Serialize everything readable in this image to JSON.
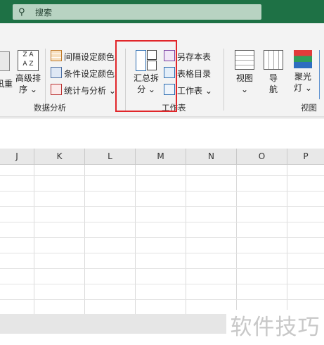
{
  "search": {
    "placeholder": "搜索",
    "icon": "search-icon"
  },
  "ribbon": {
    "analysis": {
      "partial_btn": "凪重",
      "advanced_sort": {
        "line1": "高级排",
        "line2": "序 ⌄"
      },
      "interval_color": "间隔设定颜色",
      "condition_color": "条件设定颜色",
      "stats": "统计与分析 ⌄",
      "group_label": "数据分析"
    },
    "worksheet": {
      "summary_split": {
        "line1": "汇总拆",
        "line2": "分 ⌄"
      },
      "save_as": "另存本表",
      "table_dir": "表格目录",
      "worksheet": "工作表 ⌄",
      "group_label": "工作表"
    },
    "view": {
      "view_btn": {
        "line1": "视图",
        "line2": "⌄"
      },
      "nav_btn": {
        "line1": "导",
        "line2": "航"
      },
      "spotlight_btn": {
        "line1": "聚光",
        "line2": "灯 ⌄"
      },
      "group_label": "视图"
    }
  },
  "columns": [
    "J",
    "K",
    "L",
    "M",
    "N",
    "O",
    "P"
  ],
  "watermark": "软件技巧",
  "colors": {
    "titlebar": "#1e7145",
    "highlight": "#e1262a",
    "ribbon": "#f3f3f3"
  }
}
